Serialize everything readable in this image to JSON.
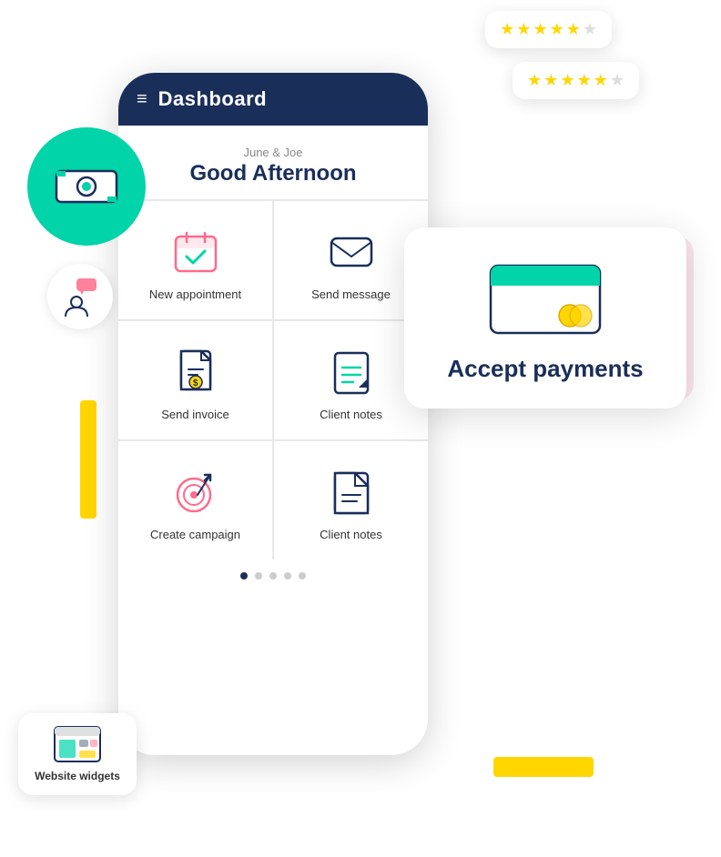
{
  "phone": {
    "header": {
      "icon": "≡",
      "title": "Dashboard"
    },
    "greeting": {
      "sub": "June & Joe",
      "main": "Good Afternoon"
    },
    "grid": [
      {
        "id": "new-appointment",
        "label": "New appointment",
        "icon": "calendar-check"
      },
      {
        "id": "send-message",
        "label": "Send message",
        "icon": "message"
      },
      {
        "id": "send-invoice",
        "label": "Send invoice",
        "icon": "invoice"
      },
      {
        "id": "client-notes",
        "label": "Client notes",
        "icon": "notes"
      },
      {
        "id": "create-campaign",
        "label": "Create campaign",
        "icon": "target"
      },
      {
        "id": "client-notes-2",
        "label": "Client notes",
        "icon": "document"
      }
    ],
    "dots": [
      true,
      false,
      false,
      false,
      false
    ]
  },
  "payments_card": {
    "title": "Accept payments"
  },
  "rating_bubble_1": {
    "stars_filled": 5,
    "stars_total": 6
  },
  "rating_bubble_2": {
    "stars_filled": 5,
    "stars_total": 6
  },
  "widgets_badge": {
    "label": "Website widgets"
  },
  "colors": {
    "navy": "#1a2e5a",
    "teal": "#00d4a8",
    "yellow": "#ffd600",
    "pink_bg": "#fce4ec"
  }
}
